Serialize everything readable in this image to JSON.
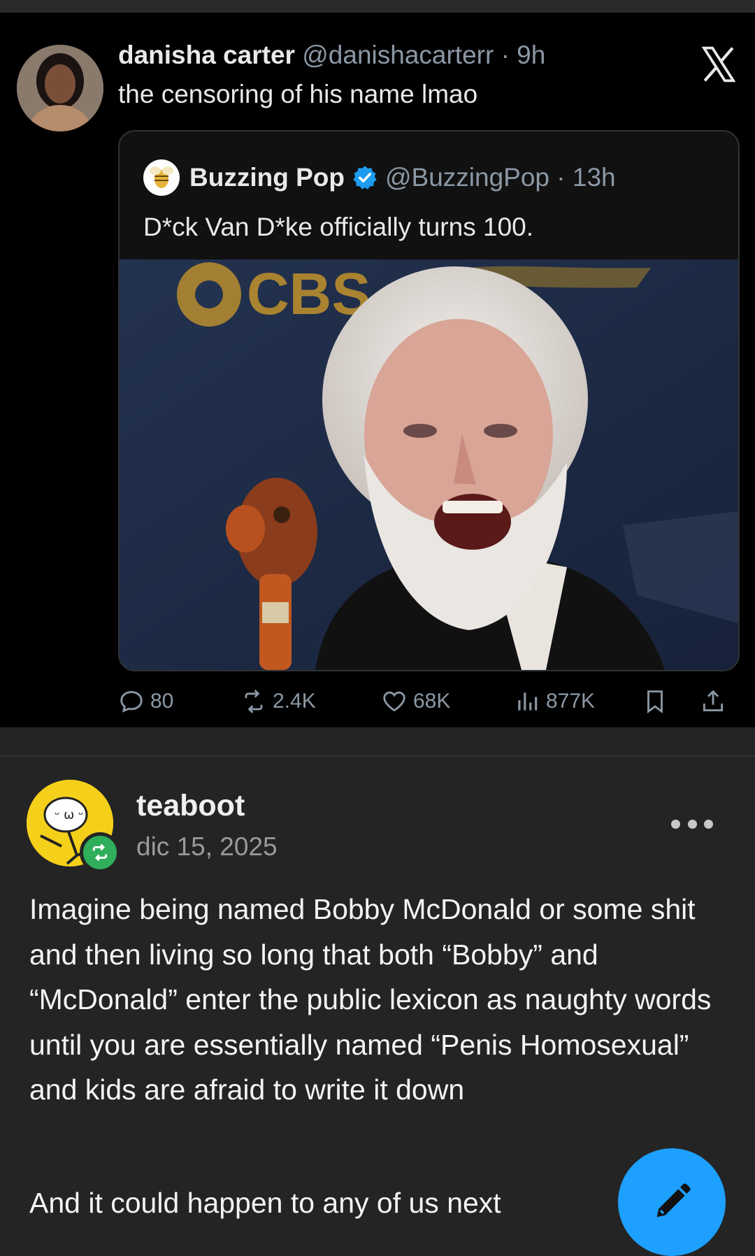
{
  "tweet": {
    "author_name": "danisha carter",
    "author_handle": "@danishacarterr · 9h",
    "text": "the censoring of his name lmao",
    "quote": {
      "author_name": "Buzzing Pop",
      "author_handle": "@BuzzingPop · 13h",
      "text": "D*ck Van D*ke officially turns 100.",
      "image_logo_text": "CBS"
    },
    "stats": {
      "replies": "80",
      "reposts": "2.4K",
      "likes": "68K",
      "views": "877K"
    }
  },
  "post": {
    "username": "teaboot",
    "date": "dic 15, 2025",
    "paragraph1": "Imagine being named Bobby McDonald or some shit and then living so long that both “Bobby” and “McDonald” enter the public lexicon as naughty words until you are essentially named “Penis Homosexual” and kids are afraid to write it down",
    "paragraph2": "And it could happen to any of us next"
  },
  "colors": {
    "tweet_bg": "#000000",
    "page_bg": "#242424",
    "verified_blue": "#1d9bf0",
    "fab_blue": "#1da0ff",
    "reblog_green": "#2fae5b"
  },
  "icons": [
    "x-logo-icon",
    "verified-icon",
    "reply-icon",
    "repost-icon",
    "like-icon",
    "views-icon",
    "bookmark-icon",
    "share-icon",
    "reblog-icon",
    "more-icon",
    "pencil-icon"
  ]
}
